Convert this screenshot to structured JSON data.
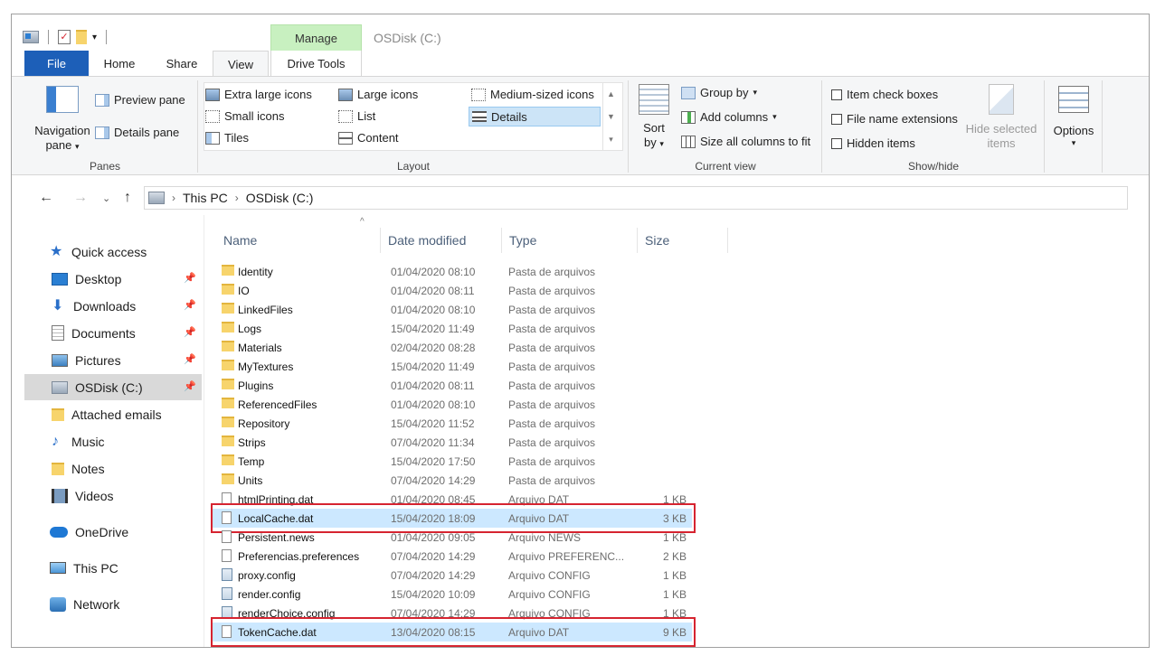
{
  "window": {
    "title": "OSDisk (C:)",
    "context_tab": "Manage"
  },
  "tabs": {
    "file": "File",
    "home": "Home",
    "share": "Share",
    "view": "View",
    "drive_tools": "Drive Tools"
  },
  "ribbon": {
    "panes": {
      "navigation_pane": "Navigation",
      "navigation_pane_2": "pane",
      "preview_pane": "Preview pane",
      "details_pane": "Details pane",
      "label": "Panes"
    },
    "layout": {
      "extra_large_icons": "Extra large icons",
      "large_icons": "Large icons",
      "medium_icons": "Medium-sized icons",
      "small_icons": "Small icons",
      "list": "List",
      "details": "Details",
      "tiles": "Tiles",
      "content": "Content",
      "label": "Layout"
    },
    "current_view": {
      "sort_by": "Sort",
      "sort_by_2": "by",
      "group_by": "Group by",
      "add_columns": "Add columns",
      "size_all_columns": "Size all columns to fit",
      "label": "Current view"
    },
    "show_hide": {
      "item_check_boxes": "Item check boxes",
      "file_name_extensions": "File name extensions",
      "hidden_items": "Hidden items",
      "hide_selected": "Hide selected",
      "hide_selected_2": "items",
      "label": "Show/hide"
    },
    "options": {
      "label": "Options"
    }
  },
  "address": {
    "this_pc": "This PC",
    "osdisk": "OSDisk (C:)"
  },
  "sidebar": [
    {
      "label": "Quick access",
      "icon": "star-icon"
    },
    {
      "label": "Desktop",
      "icon": "desktop-icon"
    },
    {
      "label": "Downloads",
      "icon": "download-icon"
    },
    {
      "label": "Documents",
      "icon": "document-icon"
    },
    {
      "label": "Pictures",
      "icon": "picture-icon"
    },
    {
      "label": "OSDisk (C:)",
      "icon": "drive-icon"
    },
    {
      "label": "Attached emails",
      "icon": "folder-icon"
    },
    {
      "label": "Music",
      "icon": "music-icon"
    },
    {
      "label": "Notes",
      "icon": "folder-icon"
    },
    {
      "label": "Videos",
      "icon": "video-icon"
    },
    {
      "label": "OneDrive",
      "icon": "cloud-icon"
    },
    {
      "label": "This PC",
      "icon": "computer-icon"
    },
    {
      "label": "Network",
      "icon": "network-icon"
    }
  ],
  "columns": {
    "name": "Name",
    "date": "Date modified",
    "type": "Type",
    "size": "Size"
  },
  "files": [
    {
      "name": "Identity",
      "date": "01/04/2020 08:10",
      "type": "Pasta de arquivos",
      "size": "",
      "kind": "folder"
    },
    {
      "name": "IO",
      "date": "01/04/2020 08:11",
      "type": "Pasta de arquivos",
      "size": "",
      "kind": "folder"
    },
    {
      "name": "LinkedFiles",
      "date": "01/04/2020 08:10",
      "type": "Pasta de arquivos",
      "size": "",
      "kind": "folder"
    },
    {
      "name": "Logs",
      "date": "15/04/2020 11:49",
      "type": "Pasta de arquivos",
      "size": "",
      "kind": "folder"
    },
    {
      "name": "Materials",
      "date": "02/04/2020 08:28",
      "type": "Pasta de arquivos",
      "size": "",
      "kind": "folder"
    },
    {
      "name": "MyTextures",
      "date": "15/04/2020 11:49",
      "type": "Pasta de arquivos",
      "size": "",
      "kind": "folder"
    },
    {
      "name": "Plugins",
      "date": "01/04/2020 08:11",
      "type": "Pasta de arquivos",
      "size": "",
      "kind": "folder"
    },
    {
      "name": "ReferencedFiles",
      "date": "01/04/2020 08:10",
      "type": "Pasta de arquivos",
      "size": "",
      "kind": "folder"
    },
    {
      "name": "Repository",
      "date": "15/04/2020 11:52",
      "type": "Pasta de arquivos",
      "size": "",
      "kind": "folder"
    },
    {
      "name": "Strips",
      "date": "07/04/2020 11:34",
      "type": "Pasta de arquivos",
      "size": "",
      "kind": "folder"
    },
    {
      "name": "Temp",
      "date": "15/04/2020 17:50",
      "type": "Pasta de arquivos",
      "size": "",
      "kind": "folder"
    },
    {
      "name": "Units",
      "date": "07/04/2020 14:29",
      "type": "Pasta de arquivos",
      "size": "",
      "kind": "folder"
    },
    {
      "name": "htmlPrinting.dat",
      "date": "01/04/2020 08:45",
      "type": "Arquivo DAT",
      "size": "1 KB",
      "kind": "doc"
    },
    {
      "name": "LocalCache.dat",
      "date": "15/04/2020 18:09",
      "type": "Arquivo DAT",
      "size": "3 KB",
      "kind": "doc",
      "selected": true
    },
    {
      "name": "Persistent.news",
      "date": "01/04/2020 09:05",
      "type": "Arquivo NEWS",
      "size": "1 KB",
      "kind": "doc"
    },
    {
      "name": "Preferencias.preferences",
      "date": "07/04/2020 14:29",
      "type": "Arquivo PREFERENC...",
      "size": "2 KB",
      "kind": "doc"
    },
    {
      "name": "proxy.config",
      "date": "07/04/2020 14:29",
      "type": "Arquivo CONFIG",
      "size": "1 KB",
      "kind": "cfg"
    },
    {
      "name": "render.config",
      "date": "15/04/2020 10:09",
      "type": "Arquivo CONFIG",
      "size": "1 KB",
      "kind": "cfg"
    },
    {
      "name": "renderChoice.config",
      "date": "07/04/2020 14:29",
      "type": "Arquivo CONFIG",
      "size": "1 KB",
      "kind": "cfg"
    },
    {
      "name": "TokenCache.dat",
      "date": "13/04/2020 08:15",
      "type": "Arquivo DAT",
      "size": "9 KB",
      "kind": "doc",
      "selected": true
    }
  ],
  "colors": {
    "file_tab": "#1d5fb8",
    "manage_tab": "#c8f0c0",
    "selection": "#cce8ff",
    "highlight_box": "#d62430"
  }
}
